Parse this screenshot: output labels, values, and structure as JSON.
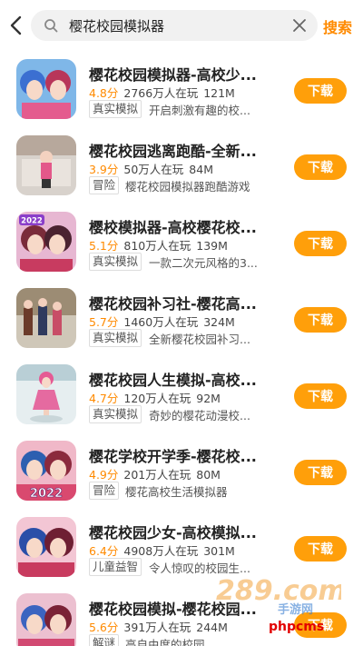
{
  "search": {
    "query": "樱花校园模拟器",
    "button_label": "搜索"
  },
  "download_label": "下载",
  "results": [
    {
      "name": "樱花校园模拟器-高校少...",
      "score": "4.8分",
      "plays": "2766万人在玩",
      "size": "121M",
      "tag": "真实模拟",
      "desc": "开启刺激有趣的校..."
    },
    {
      "name": "樱花校园逃离跑酷-全新...",
      "score": "3.9分",
      "plays": "50万人在玩",
      "size": "84M",
      "tag": "冒险",
      "desc": "樱花校园模拟器跑酷游戏"
    },
    {
      "name": "樱校模拟器-高校樱花校...",
      "score": "5.1分",
      "plays": "810万人在玩",
      "size": "139M",
      "tag": "真实模拟",
      "desc": "一款二次元风格的3..."
    },
    {
      "name": "樱花校园补习社-樱花高...",
      "score": "5.7分",
      "plays": "1460万人在玩",
      "size": "324M",
      "tag": "真实模拟",
      "desc": "全新樱花校园补习..."
    },
    {
      "name": "樱花校园人生模拟-高校...",
      "score": "4.7分",
      "plays": "120万人在玩",
      "size": "92M",
      "tag": "真实模拟",
      "desc": "奇妙的樱花动漫校..."
    },
    {
      "name": "樱花学校开学季-樱花校...",
      "score": "4.9分",
      "plays": "201万人在玩",
      "size": "80M",
      "tag": "冒险",
      "desc": "樱花高校生活模拟器"
    },
    {
      "name": "樱花校园少女-高校模拟...",
      "score": "6.4分",
      "plays": "4908万人在玩",
      "size": "301M",
      "tag": "儿童益智",
      "desc": "令人惊叹的校园生..."
    },
    {
      "name": "樱花校园模拟-樱花校园...",
      "score": "5.6分",
      "plays": "391万人在玩",
      "size": "244M",
      "tag": "解谜",
      "desc": "高自由度的校园..."
    }
  ],
  "icon_badges": {
    "item3": "2022",
    "item6": "2022"
  },
  "watermark": {
    "logo": "289.com",
    "sub": "手游网",
    "site": "phpcms"
  },
  "colors": {
    "accent": "#ff8a00",
    "download_bg": "#ff9f0a"
  }
}
